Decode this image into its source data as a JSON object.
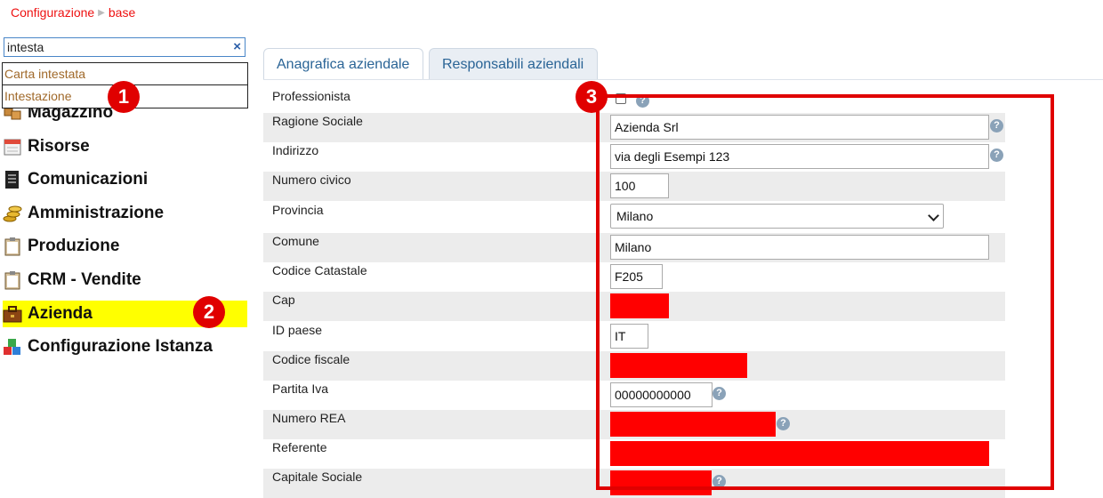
{
  "breadcrumb": {
    "root": "Configurazione",
    "current": "base"
  },
  "search": {
    "value": "intesta",
    "clear_icon": "×"
  },
  "suggestions": [
    "Carta intestata",
    "Intestazione"
  ],
  "menu": [
    {
      "label": "Magazzino",
      "icon": "boxes-icon"
    },
    {
      "label": "Risorse",
      "icon": "calendar-icon"
    },
    {
      "label": "Comunicazioni",
      "icon": "document-icon"
    },
    {
      "label": "Amministrazione",
      "icon": "coins-icon"
    },
    {
      "label": "Produzione",
      "icon": "clipboard-icon"
    },
    {
      "label": "CRM - Vendite",
      "icon": "clipboard-icon"
    },
    {
      "label": "Azienda",
      "icon": "briefcase-icon"
    },
    {
      "label": "Configurazione Istanza",
      "icon": "blocks-icon"
    }
  ],
  "markers": [
    "1",
    "2",
    "3"
  ],
  "tabs": [
    "Anagrafica aziendale",
    "Responsabili aziendali"
  ],
  "form": {
    "professionista": "Professionista",
    "ragione_sociale": {
      "label": "Ragione Sociale",
      "value": "Azienda Srl"
    },
    "indirizzo": {
      "label": "Indirizzo",
      "value": "via degli Esempi 123"
    },
    "numero_civico": {
      "label": "Numero civico",
      "value": "100"
    },
    "provincia": {
      "label": "Provincia",
      "value": "Milano"
    },
    "comune": {
      "label": "Comune",
      "value": "Milano"
    },
    "codice_catastale": {
      "label": "Codice Catastale",
      "value": "F205"
    },
    "cap": {
      "label": "Cap"
    },
    "id_paese": {
      "label": "ID paese",
      "value": "IT"
    },
    "codice_fiscale": {
      "label": "Codice fiscale"
    },
    "partita_iva": {
      "label": "Partita Iva",
      "value": "00000000000"
    },
    "numero_rea": {
      "label": "Numero REA"
    },
    "referente": {
      "label": "Referente"
    },
    "capitale_sociale": {
      "label": "Capitale Sociale"
    }
  },
  "help_symbol": "?",
  "colors": {
    "accent": "#e00000",
    "highlight": "#ffff00",
    "link": "#2a6496"
  }
}
